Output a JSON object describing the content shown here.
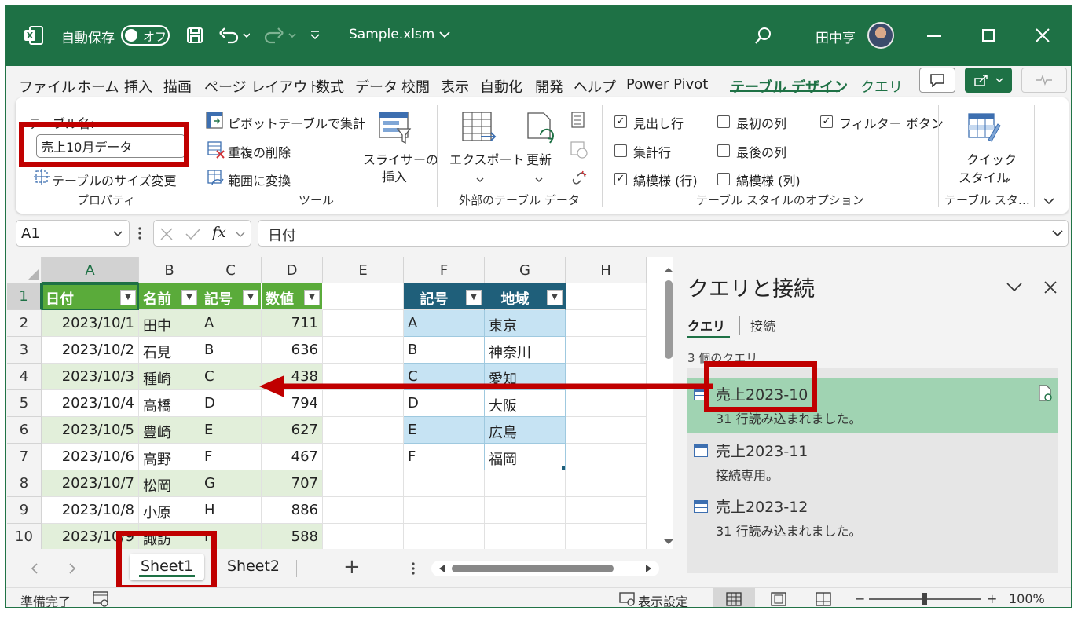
{
  "titlebar": {
    "autosave_label": "自動保存",
    "autosave_state": "オフ",
    "filename": "Sample.xlsm",
    "user_name": "田中亨"
  },
  "menu": {
    "items": [
      "ファイル",
      "ホーム",
      "挿入",
      "描画",
      "ページ レイアウト",
      "数式",
      "データ",
      "校閲",
      "表示",
      "自動化",
      "開発",
      "ヘルプ",
      "Power Pivot",
      "テーブル デザイン",
      "クエリ"
    ],
    "active": "テーブル デザイン"
  },
  "ribbon": {
    "table_name_label": "テーブル名:",
    "table_name_value": "売上10月データ",
    "resize_table": "テーブルのサイズ変更",
    "group_properties": "プロパティ",
    "pivot_summarize": "ピボットテーブルで集計",
    "remove_duplicates": "重複の削除",
    "convert_to_range": "範囲に変換",
    "insert_slicer_1": "スライサーの",
    "insert_slicer_2": "挿入",
    "group_tools": "ツール",
    "export": "エクスポート",
    "refresh": "更新",
    "group_external": "外部のテーブル データ",
    "header_row": "見出し行",
    "total_row": "集計行",
    "banded_rows": "縞模様 (行)",
    "first_column": "最初の列",
    "last_column": "最後の列",
    "banded_columns": "縞模様 (列)",
    "filter_button": "フィルター ボタン",
    "header_row_checked": true,
    "total_row_checked": false,
    "banded_rows_checked": true,
    "first_column_checked": false,
    "last_column_checked": false,
    "banded_columns_checked": false,
    "filter_button_checked": true,
    "group_style_options": "テーブル スタイルのオプション",
    "quick_style_1": "クイック",
    "quick_style_2": "スタイル",
    "group_styles": "テーブル スタ…"
  },
  "formula_bar": {
    "name_box": "A1",
    "fx": "fx",
    "content": "日付"
  },
  "grid": {
    "columns": [
      "A",
      "B",
      "C",
      "D",
      "E",
      "F",
      "G",
      "H"
    ],
    "rows": [
      "1",
      "2",
      "3",
      "4",
      "5",
      "6",
      "7",
      "8",
      "9",
      "10"
    ],
    "table1_headers": [
      "日付",
      "名前",
      "記号",
      "数値"
    ],
    "table1_rows": [
      [
        "2023/10/1",
        "田中",
        "A",
        "711"
      ],
      [
        "2023/10/2",
        "石見",
        "B",
        "636"
      ],
      [
        "2023/10/3",
        "種崎",
        "C",
        "438"
      ],
      [
        "2023/10/4",
        "高橋",
        "D",
        "794"
      ],
      [
        "2023/10/5",
        "豊崎",
        "E",
        "627"
      ],
      [
        "2023/10/6",
        "高野",
        "F",
        "467"
      ],
      [
        "2023/10/7",
        "松岡",
        "G",
        "707"
      ],
      [
        "2023/10/8",
        "小原",
        "H",
        "886"
      ],
      [
        "2023/10/9",
        "諏訪",
        "I",
        "588"
      ]
    ],
    "table2_headers": [
      "記号",
      "地域"
    ],
    "table2_rows": [
      [
        "A",
        "東京"
      ],
      [
        "B",
        "神奈川"
      ],
      [
        "C",
        "愛知"
      ],
      [
        "D",
        "大阪"
      ],
      [
        "E",
        "広島"
      ],
      [
        "F",
        "福岡"
      ]
    ]
  },
  "sheets": {
    "tabs": [
      "Sheet1",
      "Sheet2"
    ],
    "active": "Sheet1",
    "add": "+"
  },
  "queries_pane": {
    "title": "クエリと接続",
    "tab_queries": "クエリ",
    "tab_connections": "接続",
    "count": "3 個のクエリ",
    "items": [
      {
        "name": "売上2023-10",
        "status": "31 行読み込まれました。"
      },
      {
        "name": "売上2023-11",
        "status": "接続専用。"
      },
      {
        "name": "売上2023-12",
        "status": "31 行読み込まれました。"
      }
    ]
  },
  "statusbar": {
    "ready": "準備完了",
    "display_settings": "表示設定",
    "zoom": "100%",
    "minus": "−",
    "plus": "+"
  },
  "colors": {
    "excel_green": "#1e7145",
    "highlight_red": "#c00000",
    "table1_header": "#5aab3a",
    "table1_band": "#e2efda",
    "table2_header": "#1f5f7a",
    "table2_band": "#c6e3f3",
    "selected_query": "#a0d3b2"
  }
}
